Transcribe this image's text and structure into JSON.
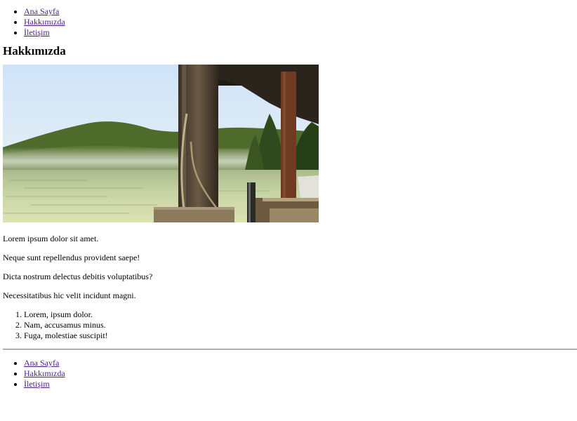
{
  "top_nav": {
    "items": [
      {
        "label": "Ana Sayfa"
      },
      {
        "label": "Hakkımızda"
      },
      {
        "label": "İletişim"
      }
    ]
  },
  "page": {
    "title": "Hakkımızda",
    "paragraphs": [
      "Lorem ipsum dolor sit amet.",
      "Neque sunt repellendus provident saepe!",
      "Dicta nostrum delectus debitis voluptatibus?",
      "Necessitatibus hic velit incidunt magni."
    ],
    "ordered_list": [
      "Lorem, ipsum dolor.",
      "Nam, accusamus minus.",
      "Fuga, molestiae suscipit!"
    ]
  },
  "bottom_nav": {
    "items": [
      {
        "label": "Ana Sayfa"
      },
      {
        "label": "Hakkımızda"
      },
      {
        "label": "İletişim"
      }
    ]
  },
  "colors": {
    "link": "#4b1f8a",
    "sky": "#d4e6f7",
    "water": "#c8d3a6",
    "forest": "#3b5a22",
    "wood": "#5a4a33"
  }
}
